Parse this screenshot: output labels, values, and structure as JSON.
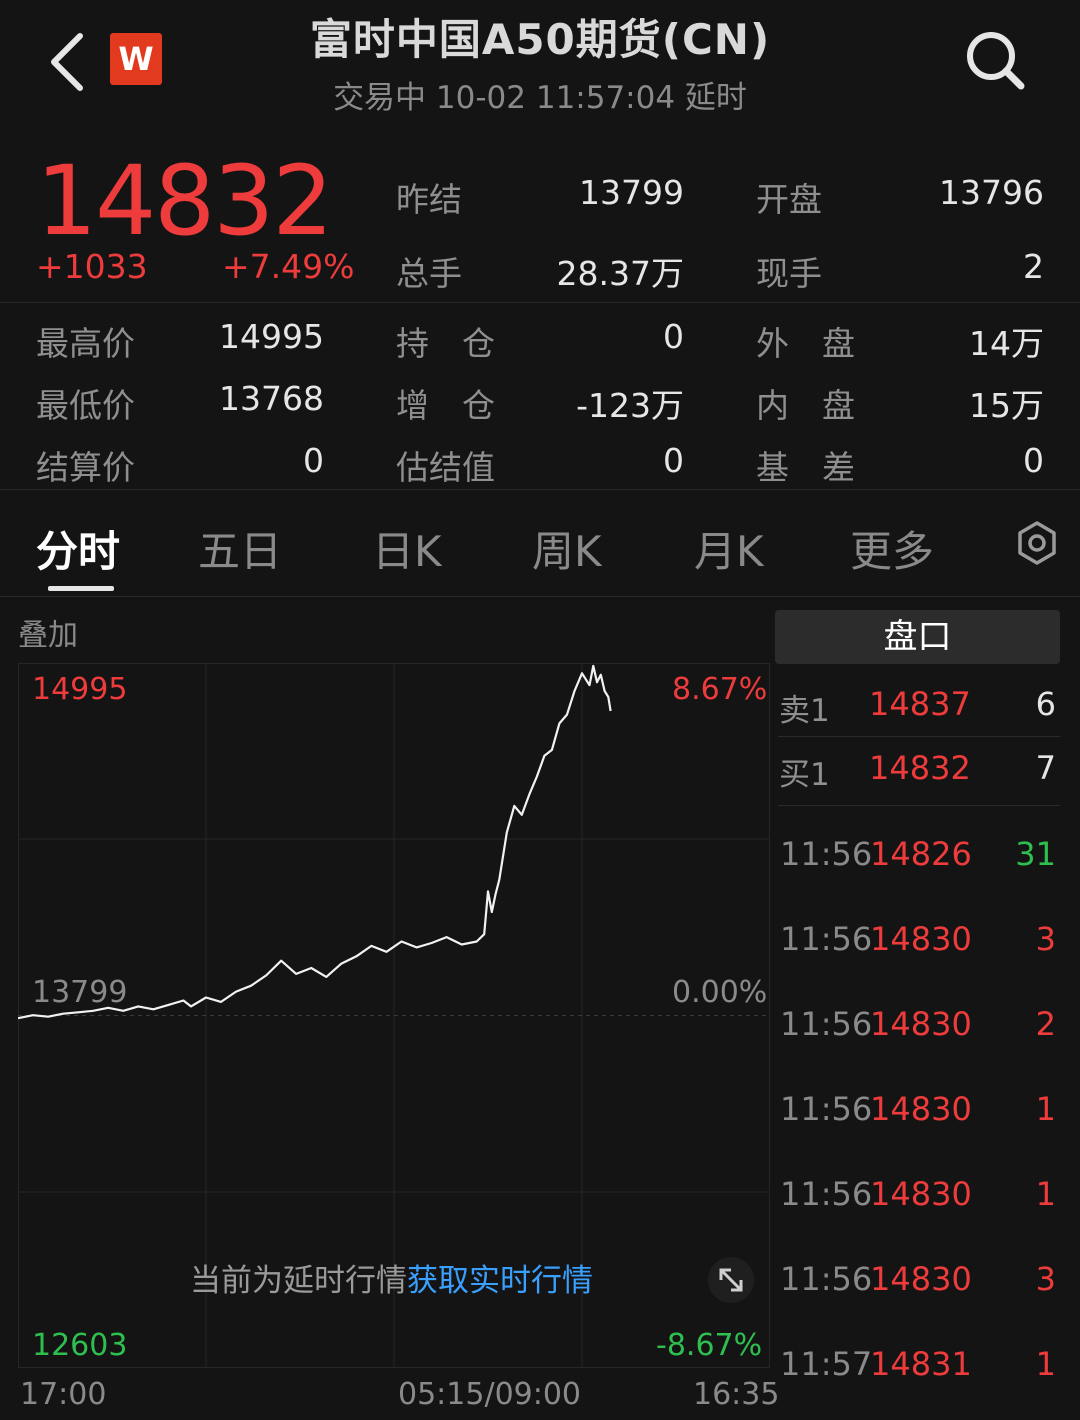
{
  "header": {
    "title": "富时中国A50期货(CN)",
    "status": "交易中 10-02 11:57:04 延时",
    "logo_letter": "W"
  },
  "quote": {
    "last": "14832",
    "change": "+1033",
    "change_pct": "+7.49%",
    "prev_settle_label": "昨结",
    "prev_settle": "13799",
    "open_label": "开盘",
    "open": "13796",
    "volume_label": "总手",
    "volume": "28.37万",
    "last_size_label": "现手",
    "last_size": "2"
  },
  "stats": {
    "high_label": "最高价",
    "high": "14995",
    "low_label": "最低价",
    "low": "13768",
    "settle_label": "结算价",
    "settle": "0",
    "oi_label": "持　仓",
    "oi": "0",
    "oi_chg_label": "增　仓",
    "oi_chg": "-123万",
    "est_settle_label": "估结值",
    "est_settle": "0",
    "outer_label": "外　盘",
    "outer": "14万",
    "inner_label": "内　盘",
    "inner": "15万",
    "basis_label": "基　差",
    "basis": "0"
  },
  "tabs": [
    "分时",
    "五日",
    "日K",
    "周K",
    "月K",
    "更多"
  ],
  "active_tab": 0,
  "chart": {
    "overlay_label": "叠加",
    "y_top": "14995",
    "y_top_pct": "8.67%",
    "y_mid": "13799",
    "y_mid_pct": "0.00%",
    "y_bot": "12603",
    "y_bot_pct": "-8.67%",
    "x_start": "17:00",
    "x_mid": "05:15/09:00",
    "x_end": "16:35",
    "delayed_text": "当前为延时行情",
    "realtime_link": "获取实时行情"
  },
  "chart_data": {
    "type": "line",
    "ylim": [
      12603,
      14995
    ],
    "baseline": 13799,
    "x": [
      0,
      2,
      4,
      6,
      8,
      10,
      12,
      14,
      16,
      18,
      20,
      22,
      23,
      25,
      27,
      29,
      31,
      33,
      35,
      37,
      39,
      41,
      43,
      45,
      47,
      49,
      51,
      53,
      55,
      57,
      59,
      61,
      62,
      62.5,
      63,
      63.5,
      64,
      65,
      66,
      67,
      68,
      69,
      70,
      71,
      72,
      73,
      74,
      75,
      76,
      76.5,
      77,
      77.5,
      78,
      78.5,
      78.8
    ],
    "values": [
      13790,
      13800,
      13795,
      13805,
      13810,
      13815,
      13825,
      13815,
      13830,
      13820,
      13835,
      13850,
      13830,
      13860,
      13845,
      13880,
      13900,
      13935,
      13985,
      13940,
      13960,
      13930,
      13975,
      14000,
      14035,
      14015,
      14050,
      14030,
      14045,
      14065,
      14040,
      14050,
      14075,
      14220,
      14150,
      14210,
      14260,
      14420,
      14510,
      14480,
      14550,
      14610,
      14680,
      14700,
      14790,
      14820,
      14900,
      14960,
      14920,
      14985,
      14930,
      14955,
      14900,
      14880,
      14832
    ]
  },
  "orderbook": {
    "title": "盘口",
    "ask_label": "卖1",
    "ask_price": "14837",
    "ask_size": "6",
    "bid_label": "买1",
    "bid_price": "14832",
    "bid_size": "7"
  },
  "ticks": [
    {
      "time": "11:56",
      "price": "14826",
      "size": "31",
      "color": "#2fbf4f"
    },
    {
      "time": "11:56",
      "price": "14830",
      "size": "3",
      "color": "#ee3b3b"
    },
    {
      "time": "11:56",
      "price": "14830",
      "size": "2",
      "color": "#ee3b3b"
    },
    {
      "time": "11:56",
      "price": "14830",
      "size": "1",
      "color": "#ee3b3b"
    },
    {
      "time": "11:56",
      "price": "14830",
      "size": "1",
      "color": "#ee3b3b"
    },
    {
      "time": "11:56",
      "price": "14830",
      "size": "3",
      "color": "#ee3b3b"
    },
    {
      "time": "11:57",
      "price": "14831",
      "size": "1",
      "color": "#ee3b3b"
    }
  ],
  "colors": {
    "up": "#ee3b3b",
    "down": "#2fbf4f",
    "link": "#3aa0ff",
    "background": "#141414"
  }
}
